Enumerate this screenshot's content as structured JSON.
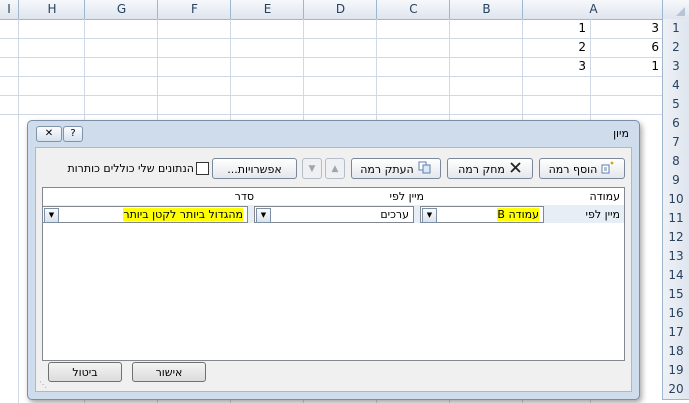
{
  "sheet": {
    "columns": [
      "I",
      "H",
      "G",
      "F",
      "E",
      "D",
      "C",
      "B",
      "A"
    ],
    "rows": [
      "1",
      "2",
      "3",
      "4",
      "5",
      "6",
      "7",
      "8",
      "9",
      "10",
      "11",
      "12",
      "13",
      "14",
      "15",
      "16",
      "17",
      "18",
      "19",
      "20"
    ],
    "cells": [
      {
        "col": "A",
        "row": "1",
        "value": "3"
      },
      {
        "col": "B",
        "row": "1",
        "value": "1"
      },
      {
        "col": "A",
        "row": "2",
        "value": "6"
      },
      {
        "col": "B",
        "row": "2",
        "value": "2"
      },
      {
        "col": "A",
        "row": "3",
        "value": "1"
      },
      {
        "col": "B",
        "row": "3",
        "value": "3"
      }
    ]
  },
  "dialog": {
    "title": "מיון",
    "help": "?",
    "close": "✕",
    "toolbar": {
      "add_level": "הוסף רמה",
      "delete_level": "מחק רמה",
      "copy_level": "העתק רמה",
      "options": "אפשרויות...",
      "headers_checkbox": "הנתונים שלי כוללים כותרות",
      "up": "▲",
      "down": "▼"
    },
    "columns_header": {
      "column": "עמודה",
      "sort_on": "מיין לפי",
      "order": "סדר"
    },
    "level": {
      "label": "מיין לפי",
      "column_value": "עמודה B",
      "sort_on_value": "ערכים",
      "order_value": "מהגדול ביותר לקטן ביותר"
    },
    "ok": "אישור",
    "cancel": "ביטול"
  },
  "colors": {
    "highlight": "#ffff00",
    "dialog_frame": "#cfdcec",
    "grid": "#d0d7e5"
  }
}
